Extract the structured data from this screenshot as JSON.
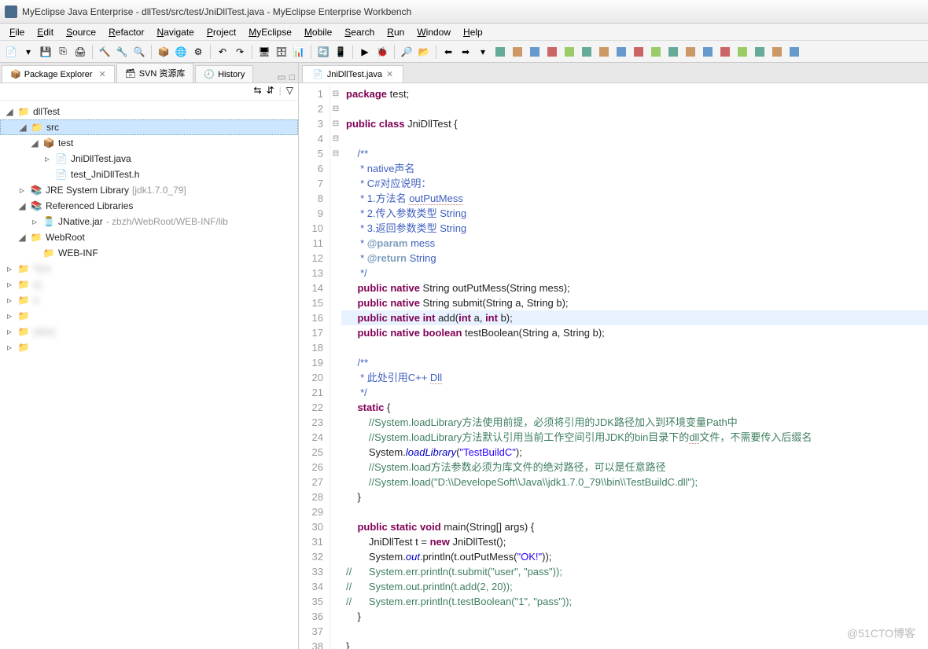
{
  "window": {
    "title": "MyEclipse Java Enterprise - dllTest/src/test/JniDllTest.java - MyEclipse Enterprise Workbench"
  },
  "menus": [
    "File",
    "Edit",
    "Source",
    "Refactor",
    "Navigate",
    "Project",
    "MyEclipse",
    "Mobile",
    "Search",
    "Run",
    "Window",
    "Help"
  ],
  "sidebar": {
    "tabs": [
      {
        "label": "Package Explorer",
        "active": true
      },
      {
        "label": "SVN 资源库",
        "active": false
      },
      {
        "label": "History",
        "active": false
      }
    ],
    "tree": {
      "project": "dllTest",
      "src": "src",
      "pkg": "test",
      "file_java": "JniDllTest.java",
      "file_h": "test_JniDllTest.h",
      "jre": "JRE System Library",
      "jre_extra": "[jdk1.7.0_79]",
      "refs": "Referenced Libraries",
      "jnative": "JNative.jar",
      "jnative_extra": " - zbzh/WebRoot/WEB-INF/lib",
      "webroot": "WebRoot",
      "webinf": "WEB-INF",
      "blurred1": "Test",
      "blurred2": "e]",
      "blurred3": "d",
      "blurred4": "yline]"
    }
  },
  "editor": {
    "tab": "JniDllTest.java",
    "highlight_line": 16,
    "lines": [
      {
        "n": 1,
        "html": "<span class='kw'>package</span> test;"
      },
      {
        "n": 2,
        "html": ""
      },
      {
        "n": 3,
        "fold": "⊟",
        "html": "<span class='kw'>public</span> <span class='kw'>class</span> JniDllTest {"
      },
      {
        "n": 4,
        "html": ""
      },
      {
        "n": 5,
        "fold": "⊟",
        "html": "    <span class='doc'>/**</span>"
      },
      {
        "n": 6,
        "html": "    <span class='doc'> * native声名</span>"
      },
      {
        "n": 7,
        "html": "    <span class='doc'> * C#对应说明：</span>"
      },
      {
        "n": 8,
        "html": "    <span class='doc'> * 1.方法名 <span class='dotted'>outPutMess</span></span>"
      },
      {
        "n": 9,
        "html": "    <span class='doc'> * 2.传入参数类型 String</span>"
      },
      {
        "n": 10,
        "html": "    <span class='doc'> * 3.返回参数类型 String</span>"
      },
      {
        "n": 11,
        "html": "    <span class='doc'> * <span class='doctag'>@param</span> mess</span>"
      },
      {
        "n": 12,
        "html": "    <span class='doc'> * <span class='doctag'>@return</span> String</span>"
      },
      {
        "n": 13,
        "html": "    <span class='doc'> */</span>"
      },
      {
        "n": 14,
        "html": "    <span class='kw'>public</span> <span class='kw'>native</span> String outPutMess(String mess);"
      },
      {
        "n": 15,
        "html": "    <span class='kw'>public</span> <span class='kw'>native</span> String submit(String a, String b);"
      },
      {
        "n": 16,
        "html": "    <span class='kw'>public</span> <span class='kw'>native</span> <span class='kw'>int</span> add(<span class='kw'>int</span> a, <span class='kw'>int</span> b);"
      },
      {
        "n": 17,
        "html": "    <span class='kw'>public</span> <span class='kw'>native</span> <span class='kw'>boolean</span> testBoolean(String a, String b);"
      },
      {
        "n": 18,
        "html": ""
      },
      {
        "n": 19,
        "fold": "⊟",
        "html": "    <span class='doc'>/**</span>"
      },
      {
        "n": 20,
        "html": "    <span class='doc'> * 此处引用C++ <span class='dotted'>Dll</span></span>"
      },
      {
        "n": 21,
        "html": "    <span class='doc'> */</span>"
      },
      {
        "n": 22,
        "fold": "⊟",
        "html": "    <span class='kw'>static</span> {"
      },
      {
        "n": 23,
        "html": "        <span class='cmt'>//System.loadLibrary方法使用前提，必须将引用的JDK路径加入到环境变量Path中</span>"
      },
      {
        "n": 24,
        "html": "        <span class='cmt'>//System.loadLibrary方法默认引用当前工作空间引用JDK的bin目录下的<span class='dotted'>dll</span>文件，不需要传入后缀名</span>"
      },
      {
        "n": 25,
        "html": "        System.<span class='fld'>loadLibrary</span>(<span class='str'>\"TestBuildC\"</span>);"
      },
      {
        "n": 26,
        "html": "        <span class='cmt'>//System.load方法参数必须为库文件的绝对路径，可以是任意路径</span>"
      },
      {
        "n": 27,
        "html": "        <span class='cmt'>//System.load(\"D:\\\\DevelopeSoft\\\\Java\\\\jdk1.7.0_79\\\\bin\\\\TestBuildC.dll\");</span>"
      },
      {
        "n": 28,
        "html": "    }"
      },
      {
        "n": 29,
        "html": ""
      },
      {
        "n": 30,
        "fold": "⊟",
        "html": "    <span class='kw'>public</span> <span class='kw'>static</span> <span class='kw'>void</span> main(String[] args) {"
      },
      {
        "n": 31,
        "html": "        JniDllTest t = <span class='kw'>new</span> JniDllTest();"
      },
      {
        "n": 32,
        "html": "        System.<span class='fld'>out</span>.println(t.outPutMess(<span class='str'>\"OK!\"</span>));"
      },
      {
        "n": 33,
        "html": "<span class='cmt'>//      System.err.println(t.submit(\"user\", \"pass\"));</span>"
      },
      {
        "n": 34,
        "html": "<span class='cmt'>//      System.out.println(t.add(2, 20));</span>"
      },
      {
        "n": 35,
        "html": "<span class='cmt'>//      System.err.println(t.testBoolean(\"1\", \"pass\"));</span>"
      },
      {
        "n": 36,
        "html": "    }"
      },
      {
        "n": 37,
        "html": ""
      },
      {
        "n": 38,
        "html": "}"
      }
    ]
  },
  "watermark": "@51CTO博客"
}
